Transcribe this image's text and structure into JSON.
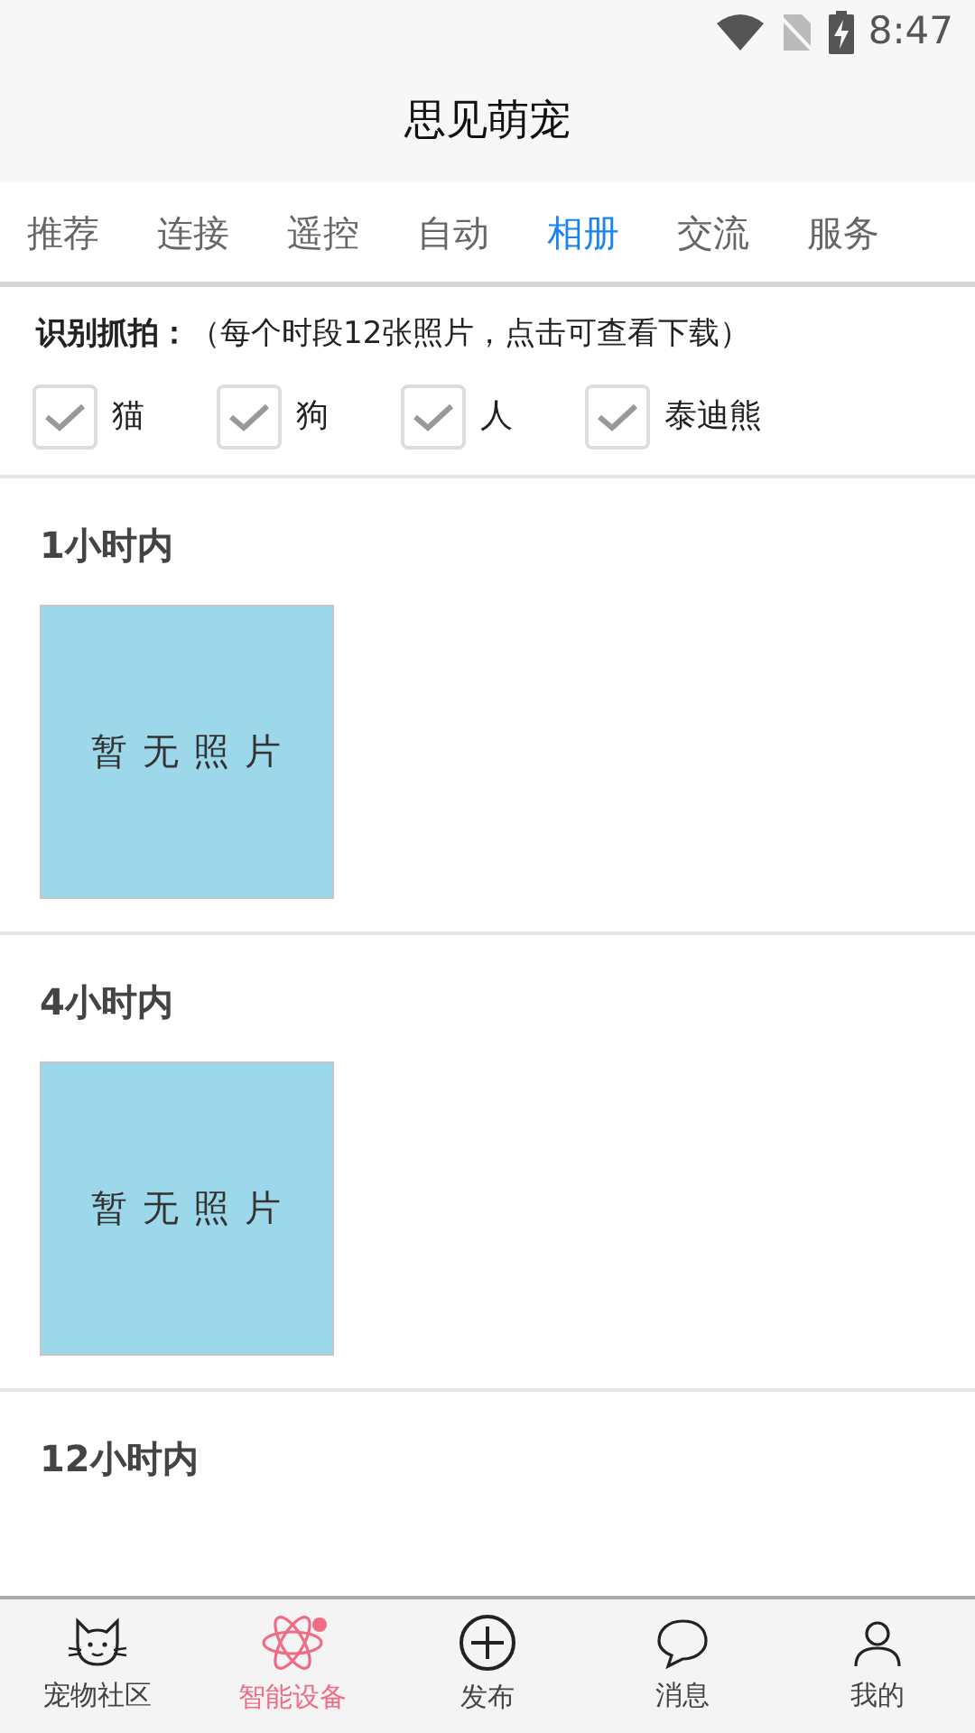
{
  "status_bar": {
    "time": "8:47"
  },
  "app_bar": {
    "title": "思见萌宠"
  },
  "tabs": [
    {
      "label": "推荐",
      "selected": false
    },
    {
      "label": "连接",
      "selected": false
    },
    {
      "label": "遥控",
      "selected": false
    },
    {
      "label": "自动",
      "selected": false
    },
    {
      "label": "相册",
      "selected": true
    },
    {
      "label": "交流",
      "selected": false
    },
    {
      "label": "服务",
      "selected": false
    }
  ],
  "capture": {
    "label": "识别抓拍：",
    "note": "（每个时段12张照片，点击可查看下载）"
  },
  "filters": [
    {
      "label": "猫",
      "checked": true
    },
    {
      "label": "狗",
      "checked": true
    },
    {
      "label": "人",
      "checked": true
    },
    {
      "label": "泰迪熊",
      "checked": true
    }
  ],
  "sections": [
    {
      "title": "1小时内",
      "photo_text": "暂 无 照 片"
    },
    {
      "title": "4小时内",
      "photo_text": "暂 无 照 片"
    },
    {
      "title": "12小时内"
    }
  ],
  "bottom_nav": [
    {
      "kind": "cat",
      "label": "宠物社区",
      "selected": false,
      "badge": false
    },
    {
      "kind": "atom",
      "label": "智能设备",
      "selected": true,
      "badge": true
    },
    {
      "kind": "plus",
      "label": "发布",
      "selected": false,
      "badge": false
    },
    {
      "kind": "chat",
      "label": "消息",
      "selected": false,
      "badge": false
    },
    {
      "kind": "person",
      "label": "我的",
      "selected": false,
      "badge": false
    }
  ]
}
